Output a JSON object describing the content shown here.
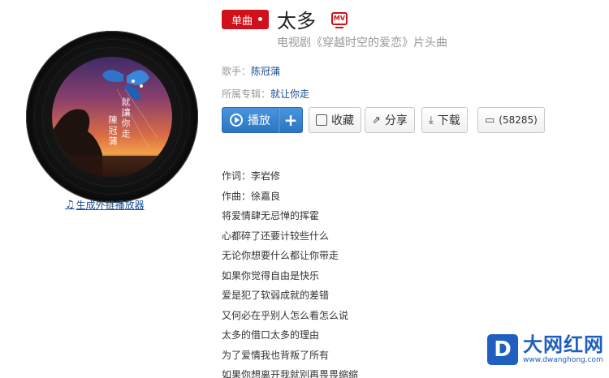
{
  "album_art": {
    "cover_text_1": "就讓你走",
    "cover_text_2": "陳冠蒲"
  },
  "embed_link": {
    "icon": "music-note-icon",
    "label": "生成外链播放器"
  },
  "song": {
    "badge": "单曲",
    "title": "太多",
    "mv_label": "MV",
    "subtitle": "电视剧《穿越时空的爱恋》片头曲"
  },
  "meta": {
    "singer_label": "歌手：",
    "singer": "陈冠蒲",
    "album_label": "所属专辑：",
    "album": "就让你走"
  },
  "actions": {
    "play": "播放",
    "add": "+",
    "collect": "收藏",
    "share": "分享",
    "download": "下载",
    "comments": "(58285)"
  },
  "lyrics": [
    "作词：李岩修",
    "作曲：徐嘉良",
    "将爱情肆无忌惮的挥霍",
    "心都碎了还要计较些什么",
    "无论你想要什么都让你带走",
    "如果你觉得自由是快乐",
    "爱是犯了软弱成就的差错",
    "又何必在乎别人怎么看怎么说",
    "太多的借口太多的理由",
    "为了爱情我也背叛了所有",
    "如果你想离开我就别再畏畏缩缩"
  ],
  "watermark": {
    "letter": "D",
    "name": "大网红网",
    "domain": "www.dwanghong.com"
  },
  "colors": {
    "accent_red": "#d0101a",
    "link_blue": "#1a4d93",
    "play_blue": "#2c74c2"
  }
}
